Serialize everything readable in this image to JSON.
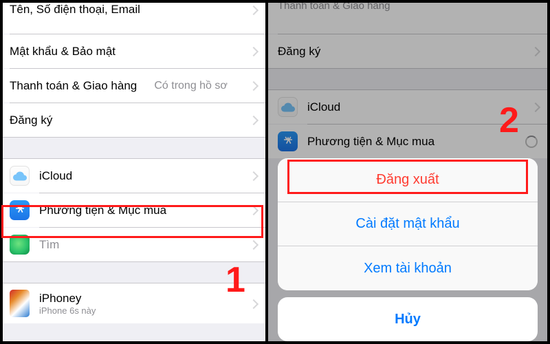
{
  "left": {
    "rows": {
      "contact": "Tên, Số điện thoại, Email",
      "password": "Mật khẩu & Bảo mật",
      "payment_label": "Thanh toán & Giao hàng",
      "payment_detail": "Có trong hồ sơ",
      "subscribe": "Đăng ký",
      "icloud": "iCloud",
      "media": "Phương tiện & Mục mua",
      "find": "Tìm"
    },
    "device": {
      "name": "iPhoney",
      "model": "iPhone 6s này"
    },
    "step": "1"
  },
  "right": {
    "bg": {
      "payment_partial": "Thanh toán & Giao hàng",
      "subscribe": "Đăng ký",
      "icloud": "iCloud",
      "media": "Phương tiện & Mục mua"
    },
    "sheet": {
      "signout": "Đăng xuất",
      "setpw": "Cài đặt mật khẩu",
      "viewacct": "Xem tài khoản"
    },
    "cancel": "Hủy",
    "step": "2"
  }
}
